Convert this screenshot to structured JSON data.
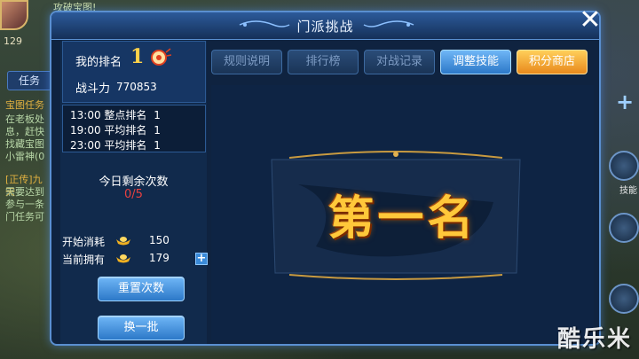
{
  "background": {
    "top_banner": "攻破宝图!",
    "level": "129",
    "task_tab": "任务",
    "task_lines": [
      "宝图任务",
      "在老板处",
      "息，赶快",
      "找藏宝图",
      "小雷神(0"
    ],
    "quest_lines": [
      "[正传]九天",
      "需要达到",
      "参与一条",
      "门任务可"
    ],
    "right_label": "技能"
  },
  "dialog": {
    "title": "门派挑战",
    "close_label": "✕"
  },
  "rank_panel": {
    "rank_label": "我的排名",
    "rank_value": "1",
    "power_label": "战斗力",
    "power_value": "770853"
  },
  "schedule": [
    {
      "time": "13:00",
      "label": "整点排名",
      "value": "1"
    },
    {
      "time": "19:00",
      "label": "平均排名",
      "value": "1"
    },
    {
      "time": "23:00",
      "label": "平均排名",
      "value": "1"
    }
  ],
  "remaining": {
    "label": "今日剩余次数",
    "value": "0/5"
  },
  "cost": {
    "start_label": "开始消耗",
    "start_value": "150",
    "owned_label": "当前拥有",
    "owned_value": "179"
  },
  "buttons": {
    "reset": "重置次数",
    "refresh": "换一批"
  },
  "tabs": {
    "rules": "规则说明",
    "leaderboard": "排行榜",
    "battle_log": "对战记录",
    "adjust_skills": "调整技能",
    "points_shop": "积分商店"
  },
  "result": {
    "text": "第一名"
  },
  "watermark": "酷乐米",
  "colors": {
    "accent_blue": "#2c78c8",
    "gold": "#e8891c",
    "rank_gold": "#ffc83a",
    "remaining_red": "#e84040"
  }
}
